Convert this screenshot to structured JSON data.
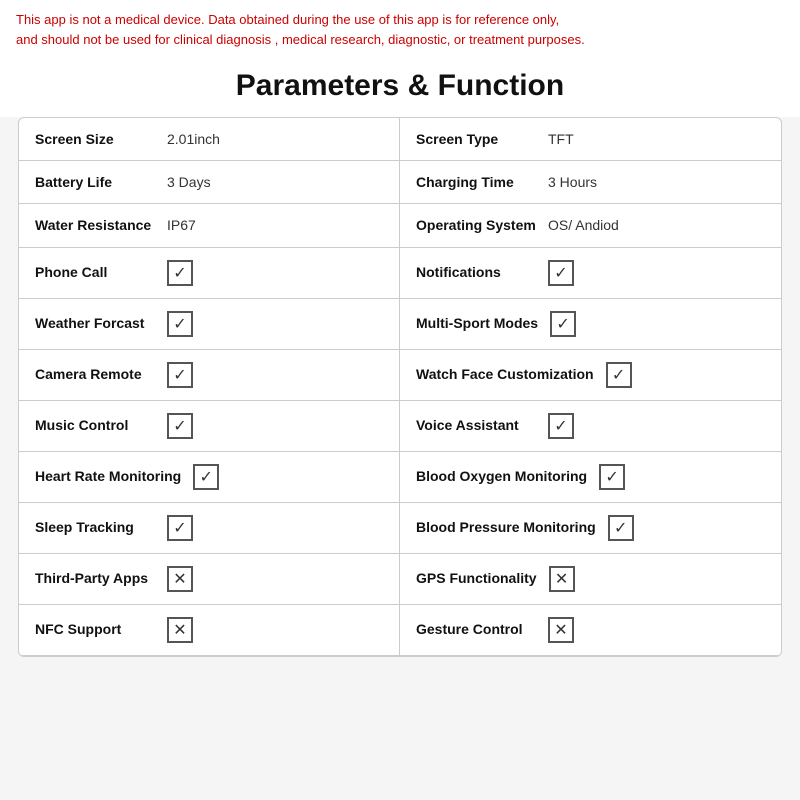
{
  "disclaimer": {
    "line1": "This app is not a medical device. Data obtained during the use of this app is for reference only,",
    "line2": "and should not be used for clinical diagnosis , medical research, diagnostic, or treatment purposes."
  },
  "title": "Parameters & Function",
  "rows": [
    {
      "left": {
        "label": "Screen Size",
        "value": "2.01inch",
        "type": "text"
      },
      "right": {
        "label": "Screen Type",
        "value": "TFT",
        "type": "text"
      }
    },
    {
      "left": {
        "label": "Battery Life",
        "value": "3 Days",
        "type": "text"
      },
      "right": {
        "label": "Charging Time",
        "value": "3 Hours",
        "type": "text"
      }
    },
    {
      "left": {
        "label": "Water Resistance",
        "value": "IP67",
        "type": "text"
      },
      "right": {
        "label": "Operating System",
        "value": "OS/ Andiod",
        "type": "text"
      }
    },
    {
      "left": {
        "label": "Phone Call",
        "value": "yes",
        "type": "check"
      },
      "right": {
        "label": "Notifications",
        "value": "yes",
        "type": "check"
      }
    },
    {
      "left": {
        "label": "Weather Forcast",
        "value": "yes",
        "type": "check"
      },
      "right": {
        "label": "Multi-Sport Modes",
        "value": "yes",
        "type": "check"
      }
    },
    {
      "left": {
        "label": "Camera Remote",
        "value": "yes",
        "type": "check"
      },
      "right": {
        "label": "Watch Face Customization",
        "value": "yes",
        "type": "check"
      }
    },
    {
      "left": {
        "label": "Music Control",
        "value": "yes",
        "type": "check"
      },
      "right": {
        "label": "Voice Assistant",
        "value": "yes",
        "type": "check"
      }
    },
    {
      "left": {
        "label": "Heart Rate Monitoring",
        "value": "yes",
        "type": "check"
      },
      "right": {
        "label": "Blood Oxygen Monitoring",
        "value": "yes",
        "type": "check"
      }
    },
    {
      "left": {
        "label": "Sleep Tracking",
        "value": "yes",
        "type": "check"
      },
      "right": {
        "label": "Blood Pressure Monitoring",
        "value": "yes",
        "type": "check"
      }
    },
    {
      "left": {
        "label": "Third-Party Apps",
        "value": "no",
        "type": "check"
      },
      "right": {
        "label": "GPS Functionality",
        "value": "no",
        "type": "check"
      }
    },
    {
      "left": {
        "label": "NFC Support",
        "value": "no",
        "type": "check"
      },
      "right": {
        "label": "Gesture Control",
        "value": "no",
        "type": "check"
      }
    }
  ]
}
